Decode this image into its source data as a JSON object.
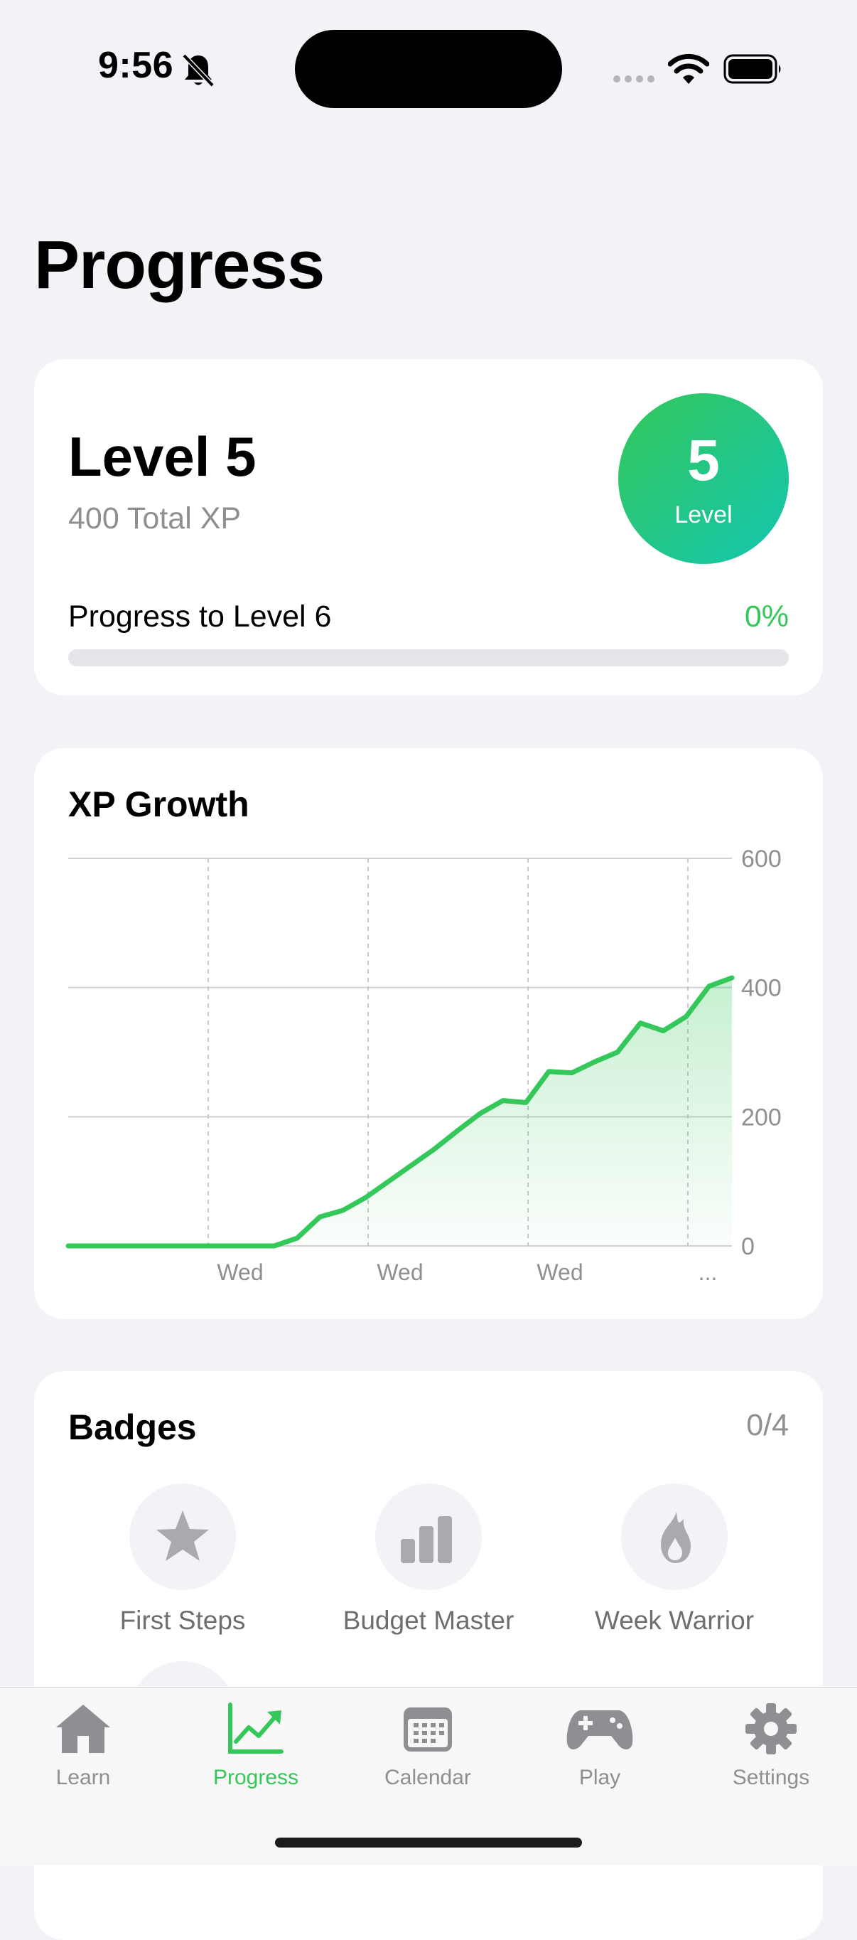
{
  "status_bar": {
    "time": "9:56"
  },
  "page": {
    "title": "Progress"
  },
  "level_card": {
    "title": "Level 5",
    "total_xp": "400 Total XP",
    "badge_number": "5",
    "badge_label": "Level",
    "progress_label": "Progress to Level 6",
    "progress_percent": "0%",
    "progress_fraction": 0
  },
  "chart_card": {
    "title": "XP Growth"
  },
  "chart_data": {
    "type": "area",
    "y_ticks": [
      "600",
      "400",
      "200",
      "0"
    ],
    "x_tick_labels": [
      "Wed",
      "Wed",
      "Wed",
      "..."
    ],
    "ylim": [
      0,
      600
    ],
    "grid": true,
    "line_color": "#34c759",
    "series": [
      {
        "values": [
          0,
          0,
          0,
          0,
          0,
          0,
          0,
          0,
          0,
          0,
          12,
          45,
          55,
          75,
          100,
          125,
          150,
          178,
          205,
          225,
          222,
          270,
          268,
          285,
          300,
          345,
          333,
          355,
          402,
          415
        ]
      }
    ]
  },
  "badges_card": {
    "title": "Badges",
    "count": "0/4",
    "items": [
      {
        "name": "First Steps",
        "icon": "star-icon"
      },
      {
        "name": "Budget Master",
        "icon": "bar-chart-icon"
      },
      {
        "name": "Week Warrior",
        "icon": "flame-icon"
      }
    ]
  },
  "tab_bar": {
    "items": [
      {
        "label": "Learn",
        "icon": "house-icon"
      },
      {
        "label": "Progress",
        "icon": "chart-icon"
      },
      {
        "label": "Calendar",
        "icon": "calendar-icon"
      },
      {
        "label": "Play",
        "icon": "gamepad-icon"
      },
      {
        "label": "Settings",
        "icon": "gear-icon"
      }
    ],
    "active": "Progress"
  },
  "colors": {
    "accent": "#34c759",
    "level_gradient_end": "#13c6b0",
    "muted": "#8e8e93"
  }
}
